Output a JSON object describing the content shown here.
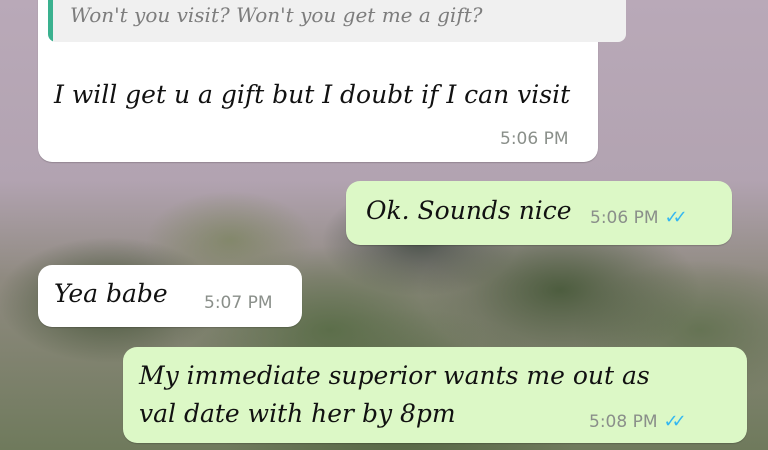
{
  "chat": {
    "messages": [
      {
        "direction": "incoming",
        "quoted_text": "Won't you visit? Won't you get me a gift?",
        "text": "I will get u a gift but I doubt if I can visit",
        "time": "5:06 PM"
      },
      {
        "direction": "outgoing",
        "text": "Ok. Sounds nice",
        "time": "5:06 PM",
        "status_icon": "double-check-read-icon"
      },
      {
        "direction": "incoming",
        "text": "Yea babe",
        "time": "5:07 PM"
      },
      {
        "direction": "outgoing",
        "text_line1": "My immediate superior wants me out as",
        "text_line2": "val date with her by 8pm",
        "time": "5:08 PM",
        "status_icon": "double-check-read-icon"
      }
    ]
  },
  "colors": {
    "incoming_bubble": "#ffffff",
    "outgoing_bubble": "#dcf8c6",
    "read_ticks": "#34b7f1",
    "quote_bar": "#3ab18f"
  }
}
